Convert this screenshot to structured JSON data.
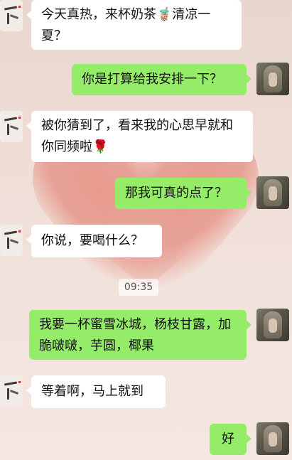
{
  "chat": {
    "timestamp": "09:35",
    "messages": [
      {
        "side": "left",
        "text": "今天真热，来杯奶茶🧋清凉一夏？"
      },
      {
        "side": "right",
        "text": "你是打算给我安排一下？"
      },
      {
        "side": "left",
        "text": "被你猜到了，看来我的心思早就和你同频啦🌹"
      },
      {
        "side": "right",
        "text": "那我可真的点了？"
      },
      {
        "side": "left",
        "text": "你说，要喝什么？"
      },
      {
        "side": "right",
        "text": "我要一杯蜜雪冰城，杨枝甘露，加脆啵啵，芋圆，椰果"
      },
      {
        "side": "left",
        "text": "等着啊，马上就到"
      },
      {
        "side": "right",
        "text": "好"
      }
    ]
  },
  "colors": {
    "incoming_bubble": "#ffffff",
    "outgoing_bubble": "#95ec69"
  }
}
